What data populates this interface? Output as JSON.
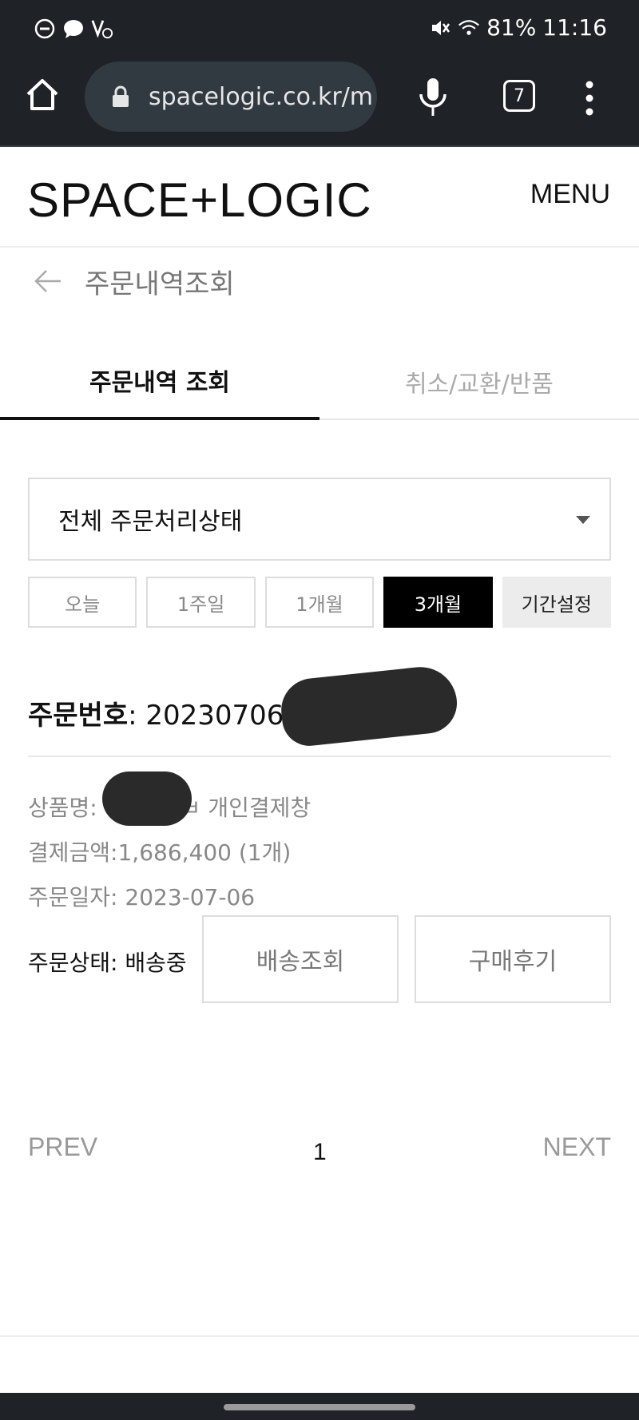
{
  "status_bar": {
    "battery": "81%",
    "time": "11:16",
    "icons": [
      "dnd-icon",
      "chat-icon",
      "volte-icon",
      "mute-icon",
      "wifi-icon"
    ]
  },
  "browser": {
    "url": "spacelogic.co.kr/m",
    "tab_count": "7",
    "icons": [
      "home-icon",
      "lock-icon",
      "mic-icon",
      "tabs-icon",
      "more-icon"
    ]
  },
  "header": {
    "logo": "SPACE+LOGIC",
    "menu": "MENU"
  },
  "page": {
    "title": "주문내역조회"
  },
  "tabs": [
    {
      "label": "주문내역 조회",
      "active": true
    },
    {
      "label": "취소/교환/반품",
      "active": false
    }
  ],
  "filter": {
    "status_select": "전체 주문처리상태",
    "periods": [
      "오늘",
      "1주일",
      "1개월",
      "3개월"
    ],
    "active_period": "3개월",
    "custom_period": "기간설정"
  },
  "order": {
    "number_label": "주문번호",
    "number_value": ": 20230706-0",
    "product_label": "상품명:",
    "product_suffix": "ㅂ 개인결제창",
    "amount": "결제금액:1,686,400 (1개)",
    "date": "주문일자: 2023-07-06",
    "status": "주문상태: 배송중",
    "track_button": "배송조회",
    "review_button": "구매후기"
  },
  "pagination": {
    "prev": "PREV",
    "page": "1",
    "next": "NEXT"
  },
  "colors": {
    "system_bar": "#1f2226",
    "url_box": "#323a41",
    "active_period": "#000000",
    "muted_text": "#888888"
  }
}
